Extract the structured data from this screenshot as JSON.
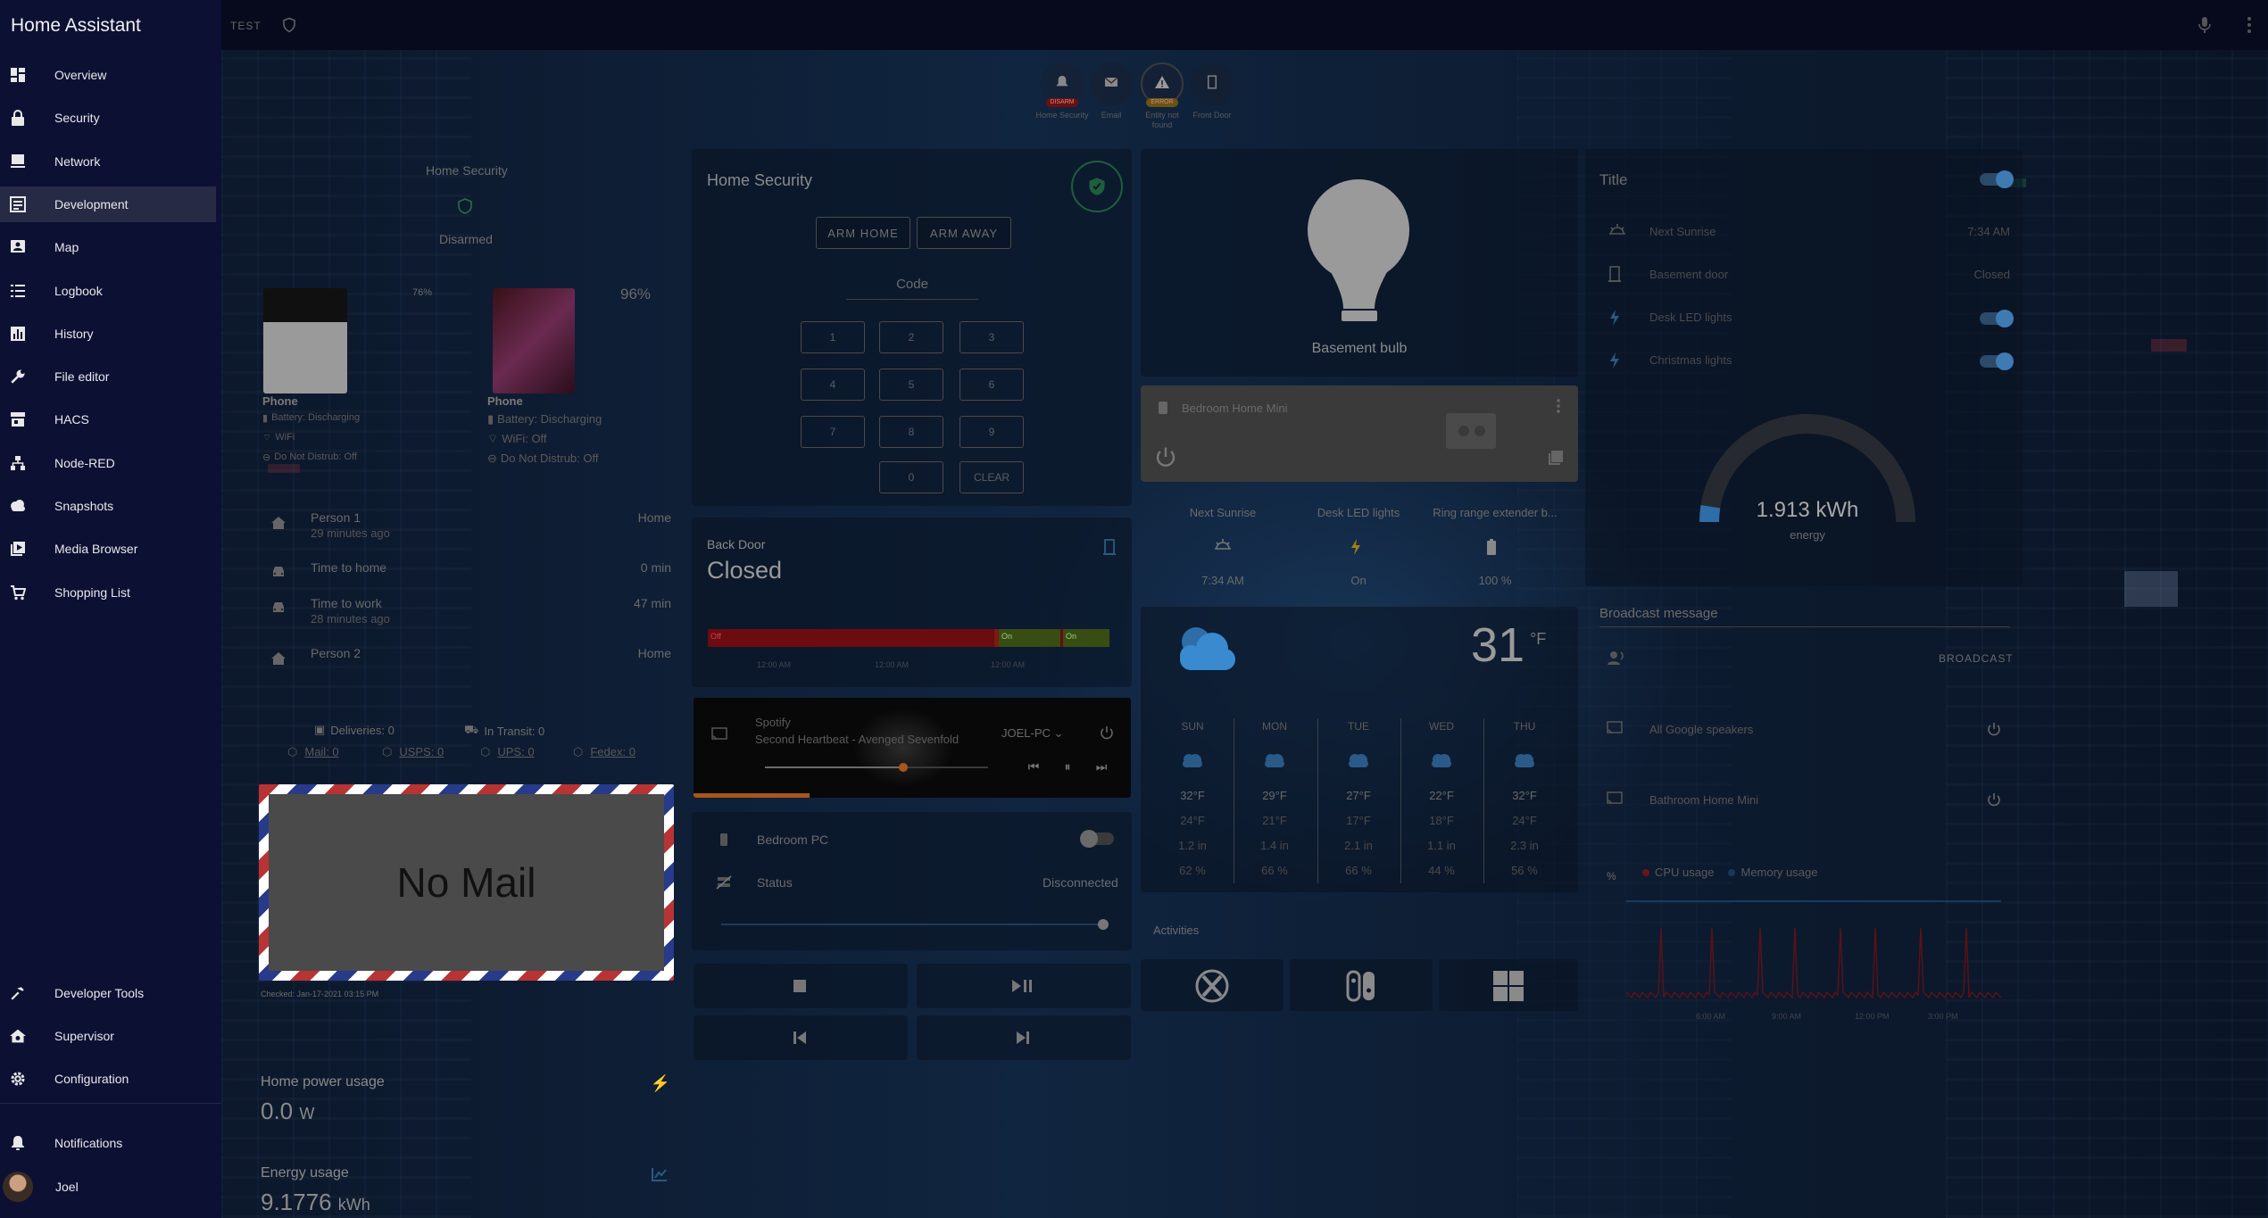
{
  "app": {
    "title": "Home Assistant",
    "env_label": "TEST"
  },
  "sidebar": {
    "items": [
      {
        "label": "Overview",
        "icon": "dashboard-icon"
      },
      {
        "label": "Security",
        "icon": "lock-icon"
      },
      {
        "label": "Network",
        "icon": "monitor-icon"
      },
      {
        "label": "Development",
        "icon": "code-icon",
        "active": true
      },
      {
        "label": "Map",
        "icon": "map-person-icon"
      },
      {
        "label": "Logbook",
        "icon": "list-icon"
      },
      {
        "label": "History",
        "icon": "chart-box-icon"
      },
      {
        "label": "File editor",
        "icon": "wrench-icon"
      },
      {
        "label": "HACS",
        "icon": "store-icon"
      },
      {
        "label": "Node-RED",
        "icon": "sitemap-icon"
      },
      {
        "label": "Snapshots",
        "icon": "cloud-icon"
      },
      {
        "label": "Media Browser",
        "icon": "play-box-icon"
      },
      {
        "label": "Shopping List",
        "icon": "cart-icon"
      }
    ],
    "bottom": {
      "developer_tools": "Developer Tools",
      "supervisor": "Supervisor",
      "configuration": "Configuration",
      "notifications": "Notifications",
      "user": "Joel"
    }
  },
  "badges": [
    {
      "label": "Home Security",
      "tag": "DISARM",
      "icon": "bell-icon"
    },
    {
      "label": "Email",
      "tag": "",
      "icon": "mail-icon"
    },
    {
      "label": "Entity not found",
      "tag": "ERROR",
      "icon": "alert-icon"
    },
    {
      "label": "Front Door",
      "tag": "",
      "icon": "door-icon"
    }
  ],
  "security_small": {
    "title": "Home Security",
    "state": "Disarmed"
  },
  "phones": [
    {
      "name": "Phone",
      "battery_pct": "76%",
      "battery": "Battery: Discharging",
      "wifi": "WiFi",
      "dnd": "Do Not Distrub: Off"
    },
    {
      "name": "Phone",
      "battery_pct": "96%",
      "battery": "Battery: Discharging",
      "wifi": "WiFi: Off",
      "dnd": "Do Not Distrub: Off"
    }
  ],
  "people": [
    {
      "name": "Person 1",
      "sub": "29 minutes ago",
      "state": "Home",
      "icon": "home-icon"
    },
    {
      "name": "Time to home",
      "sub": "",
      "state": "0 min",
      "icon": "car-icon"
    },
    {
      "name": "Time to work",
      "sub": "28 minutes ago",
      "state": "47 min",
      "icon": "car-icon"
    },
    {
      "name": "Person 2",
      "sub": "",
      "state": "Home",
      "icon": "home-icon"
    }
  ],
  "mail": {
    "deliveries": "Deliveries: 0",
    "in_transit": "In Transit: 0",
    "links": [
      "Mail: 0",
      "USPS: 0",
      "UPS: 0",
      "Fedex: 0"
    ],
    "banner": "No Mail",
    "checked": "Checked: Jan-17-2021 03:15 PM"
  },
  "power": {
    "title": "Home power usage",
    "value": "0.0",
    "unit": "W"
  },
  "energy": {
    "title": "Energy usage",
    "value": "9.1776",
    "unit": "kWh"
  },
  "alarm_panel": {
    "title": "Home Security",
    "arm_home": "ARM HOME",
    "arm_away": "ARM AWAY",
    "code_label": "Code",
    "keys": [
      "1",
      "2",
      "3",
      "4",
      "5",
      "6",
      "7",
      "8",
      "9",
      "0",
      "CLEAR"
    ]
  },
  "back_door": {
    "title": "Back Door",
    "state": "Closed",
    "segments": [
      "Off",
      "On",
      "On"
    ],
    "times": [
      "12:00 AM",
      "12:00 AM",
      "12:00 AM"
    ]
  },
  "media": {
    "source": "Spotify",
    "track": "Second Heartbeat - Avenged Sevenfold",
    "device": "JOEL-PC",
    "progress": 0.62
  },
  "pc": {
    "name": "Bedroom PC",
    "status_label": "Status",
    "status": "Disconnected"
  },
  "bulb": {
    "name": "Basement bulb"
  },
  "mini_card": {
    "name": "Bedroom Home Mini"
  },
  "glance": [
    {
      "label": "Next Sunrise",
      "value": "7:34 AM",
      "icon": "sunrise-icon"
    },
    {
      "label": "Desk LED lights",
      "value": "On",
      "icon": "flash-icon"
    },
    {
      "label": "Ring range extender b...",
      "value": "100 %",
      "icon": "battery-icon"
    }
  ],
  "weather": {
    "temp": "31",
    "unit": "°F",
    "days": [
      {
        "day": "SUN",
        "high": "32°F",
        "low": "24°F",
        "precip": "1.2 in",
        "pct": "62 %"
      },
      {
        "day": "MON",
        "high": "29°F",
        "low": "21°F",
        "precip": "1.4 in",
        "pct": "66 %"
      },
      {
        "day": "TUE",
        "high": "27°F",
        "low": "17°F",
        "precip": "2.1 in",
        "pct": "66 %"
      },
      {
        "day": "WED",
        "high": "22°F",
        "low": "18°F",
        "precip": "1.1 in",
        "pct": "44 %"
      },
      {
        "day": "THU",
        "high": "32°F",
        "low": "24°F",
        "precip": "2.3 in",
        "pct": "56 %"
      }
    ]
  },
  "activities": {
    "title": "Activities",
    "items": [
      "xbox-icon",
      "switch-icon",
      "windows-icon"
    ]
  },
  "entities": {
    "title": "Title",
    "rows": [
      {
        "name": "Next Sunrise",
        "value": "7:34 AM",
        "icon": "sunrise-icon"
      },
      {
        "name": "Basement door",
        "value": "Closed",
        "icon": "door-icon"
      },
      {
        "name": "Desk LED lights",
        "value": "",
        "icon": "flash-icon"
      },
      {
        "name": "Christmas lights",
        "value": "",
        "icon": "flash-icon"
      }
    ]
  },
  "gauge": {
    "value": "1.913 kWh",
    "label": "energy",
    "fraction": 0.05
  },
  "broadcast": {
    "label": "Broadcast message",
    "button": "BROADCAST",
    "speakers": [
      "All Google speakers",
      "Bathroom Home Mini"
    ]
  },
  "cpu_chart": {
    "legend": [
      "CPU usage",
      "Memory usage"
    ],
    "y_unit": "%",
    "times": [
      "6:00 AM",
      "9:00 AM",
      "12:00 PM",
      "3:00 PM"
    ]
  }
}
